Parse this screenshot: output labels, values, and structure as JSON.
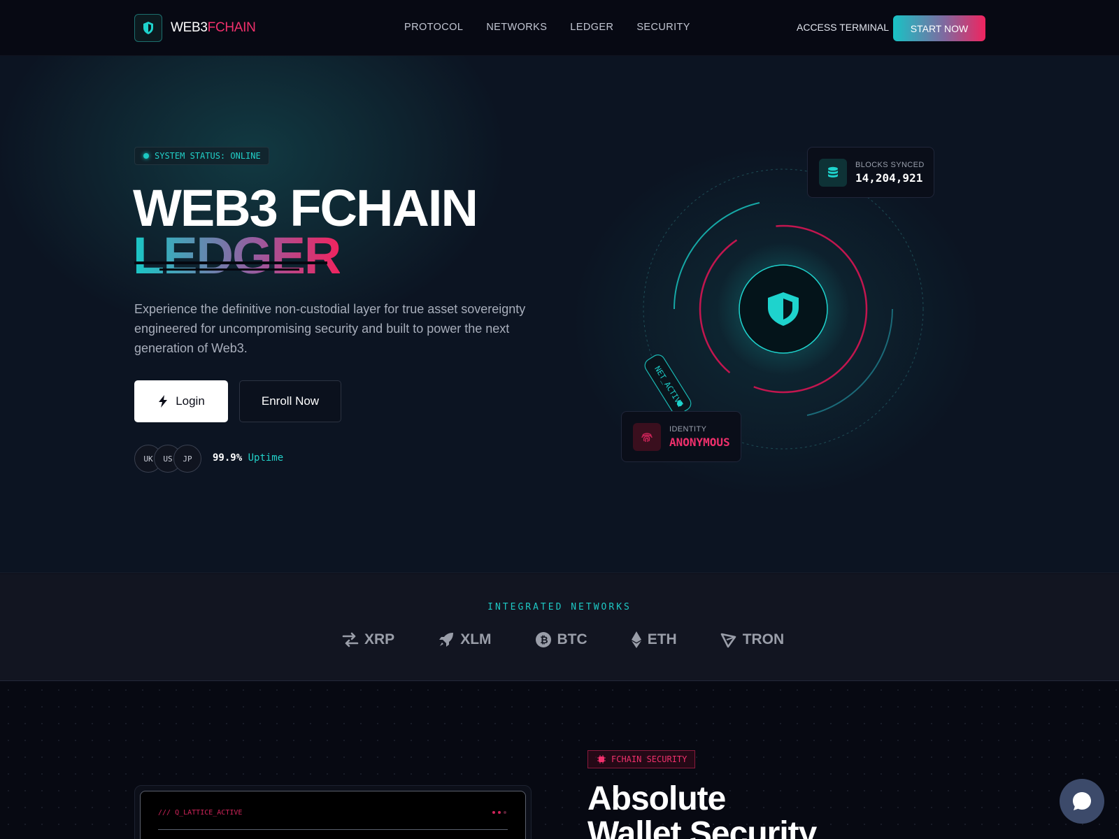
{
  "nav": {
    "logo_word_a": "WEB3",
    "logo_word_b": "FCHAIN",
    "links": [
      "PROTOCOL",
      "NETWORKS",
      "LEDGER",
      "SECURITY"
    ],
    "access_label": "ACCESS TERMINAL",
    "start_label": "START NOW"
  },
  "hero": {
    "status": "SYSTEM STATUS: ONLINE",
    "title_line1": "WEB3 FCHAIN",
    "title_line2": "LEDGER",
    "description": "Experience the definitive non-custodial layer for true asset sovereignty engineered for uncompromising security and built to power the next generation of Web3.",
    "login_label": "Login",
    "enroll_label": "Enroll Now",
    "flags": [
      "UK",
      "US",
      "JP"
    ],
    "uptime_value": "99.9%",
    "uptime_label": "Uptime",
    "blocks_label": "BLOCKS SYNCED",
    "blocks_value": "14,204,921",
    "net_tag": "NET_ACTIVE",
    "identity_label": "IDENTITY",
    "identity_value": "ANONYMOUS"
  },
  "networks": {
    "title": "INTEGRATED NETWORKS",
    "items": [
      {
        "name": "XRP",
        "icon": "exchange-arrows-icon"
      },
      {
        "name": "XLM",
        "icon": "rocket-icon"
      },
      {
        "name": "BTC",
        "icon": "bitcoin-icon"
      },
      {
        "name": "ETH",
        "icon": "ethereum-icon"
      },
      {
        "name": "TRON",
        "icon": "tron-icon"
      }
    ]
  },
  "security": {
    "terminal_title": "/// Q_LATTICE_ACTIVE",
    "pill": "FCHAIN SECURITY",
    "heading_line1": "Absolute",
    "heading_line2": "Wallet Security"
  },
  "colors": {
    "accent_cyan": "#1cc9c3",
    "accent_pink": "#f0306c",
    "background": "#0b0d18"
  }
}
